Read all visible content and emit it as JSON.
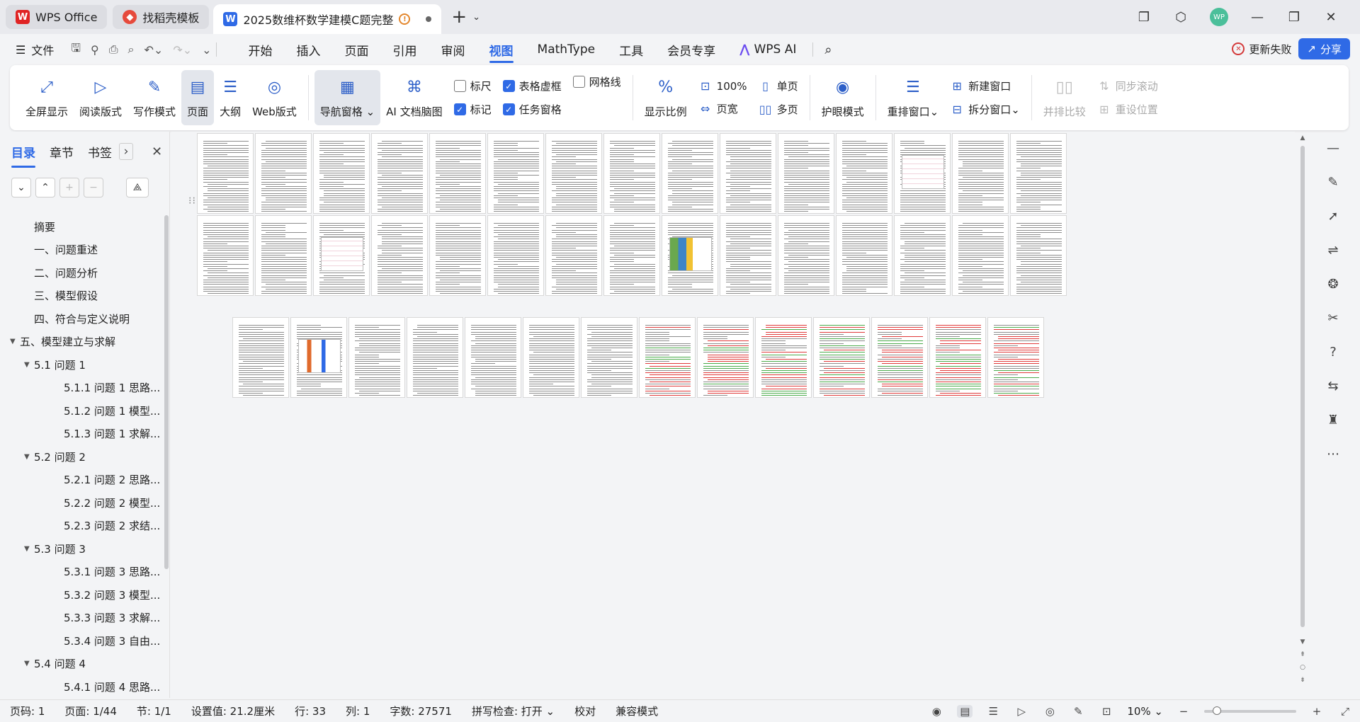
{
  "tabs": [
    {
      "label": "WPS Office",
      "icon": "wps-logo-icon"
    },
    {
      "label": "找稻壳模板",
      "icon": "daoke-logo-icon"
    },
    {
      "label": "2025数维杯数学建模C题完整",
      "icon": "doc-icon"
    }
  ],
  "avatar_text": "WP",
  "menu": {
    "file": "文件",
    "items": [
      "开始",
      "插入",
      "页面",
      "引用",
      "审阅",
      "视图",
      "MathType",
      "工具",
      "会员专享"
    ],
    "active": "视图",
    "wps_ai": "WPS AI",
    "update_fail": "更新失败",
    "share": "分享"
  },
  "ribbon": {
    "fullscreen": "全屏显示",
    "read_mode": "阅读版式",
    "write_mode": "写作模式",
    "page": "页面",
    "outline": "大纲",
    "web": "Web版式",
    "nav_pane": "导航窗格",
    "ai_map": "AI 文档脑图",
    "ruler": "标尺",
    "table_grid": "表格虚框",
    "gridlines": "网格线",
    "marks": "标记",
    "task_pane": "任务窗格",
    "zoom": "显示比例",
    "zoom100": "100%",
    "page_width": "页宽",
    "single_page": "单页",
    "multi_page": "多页",
    "eye_care": "护眼模式",
    "rearrange": "重排窗口",
    "new_window": "新建窗口",
    "split_window": "拆分窗口",
    "side_by_side": "并排比较",
    "sync_scroll": "同步滚动",
    "reset_pos": "重设位置"
  },
  "checkboxes": {
    "ruler": false,
    "table_grid": true,
    "gridlines": false,
    "marks": true,
    "task_pane": true
  },
  "nav": {
    "tabs": [
      "目录",
      "章节",
      "书签"
    ],
    "toc": [
      {
        "text": "摘要",
        "level": 0,
        "caret": ""
      },
      {
        "text": "一、问题重述",
        "level": 0,
        "caret": ""
      },
      {
        "text": "二、问题分析",
        "level": 0,
        "caret": ""
      },
      {
        "text": "三、模型假设",
        "level": 0,
        "caret": ""
      },
      {
        "text": "四、符合与定义说明",
        "level": 0,
        "caret": ""
      },
      {
        "text": "五、模型建立与求解",
        "level": 0,
        "caret": "▼"
      },
      {
        "text": "5.1 问题 1",
        "level": 1,
        "caret": "▼"
      },
      {
        "text": "5.1.1 问题 1 思路...",
        "level": 2,
        "caret": ""
      },
      {
        "text": "5.1.2 问题 1 模型...",
        "level": 2,
        "caret": ""
      },
      {
        "text": "5.1.3 问题 1 求解...",
        "level": 2,
        "caret": ""
      },
      {
        "text": "5.2 问题 2",
        "level": 1,
        "caret": "▼"
      },
      {
        "text": "5.2.1 问题 2 思路...",
        "level": 2,
        "caret": ""
      },
      {
        "text": "5.2.2 问题 2 模型...",
        "level": 2,
        "caret": ""
      },
      {
        "text": "5.2.3 问题 2 求结...",
        "level": 2,
        "caret": ""
      },
      {
        "text": "5.3 问题 3",
        "level": 1,
        "caret": "▼"
      },
      {
        "text": "5.3.1 问题 3 思路...",
        "level": 2,
        "caret": ""
      },
      {
        "text": "5.3.2 问题 3 模型...",
        "level": 2,
        "caret": ""
      },
      {
        "text": "5.3.3 问题 3 求解...",
        "level": 2,
        "caret": ""
      },
      {
        "text": "5.3.4 问题 3 自由...",
        "level": 2,
        "caret": ""
      },
      {
        "text": "5.4 问题 4",
        "level": 1,
        "caret": "▼"
      },
      {
        "text": "5.4.1 问题 4 思路...",
        "level": 2,
        "caret": ""
      }
    ]
  },
  "status": {
    "page_num": "页码: 1",
    "page_of": "页面: 1/44",
    "section": "节: 1/1",
    "setting": "设置值: 21.2厘米",
    "row": "行: 33",
    "col": "列: 1",
    "word_count": "字数: 27571",
    "spell": "拼写检查: 打开",
    "proof": "校对",
    "compat": "兼容模式",
    "zoom": "10%",
    "zoom_fraction": 0.1
  },
  "document": {
    "total_pages": 44,
    "pages_per_row": [
      15,
      15,
      14
    ]
  }
}
